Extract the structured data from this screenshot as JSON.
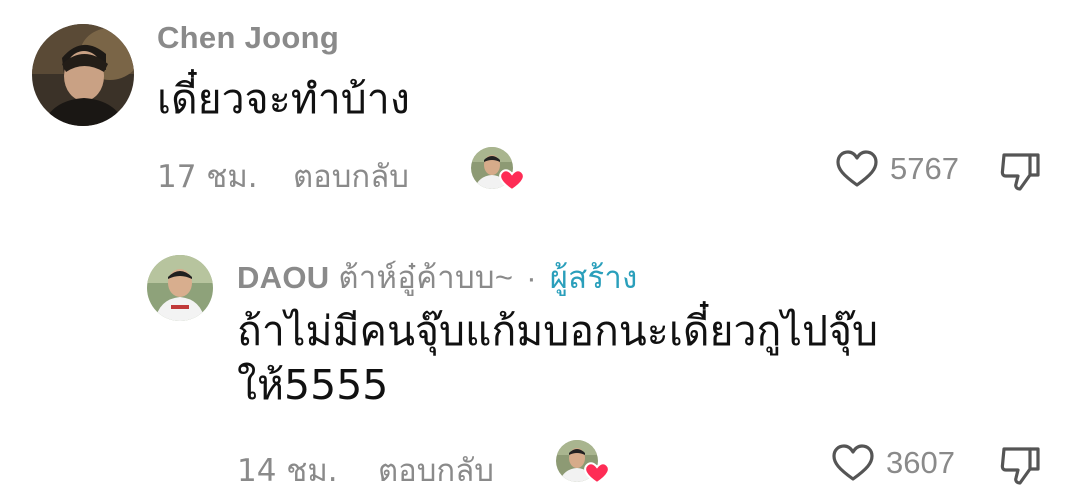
{
  "comments": [
    {
      "author": "Chen Joong",
      "text": "เดี๋ยวจะทำบ้าง",
      "time": "17 ชม.",
      "reply_label": "ตอบกลับ",
      "likes": "5767"
    }
  ],
  "reply": {
    "author": "DAOU",
    "nickname": "ต้าห์อู๋ค้าบบ~",
    "separator": "·",
    "creator_label": "ผู้สร้าง",
    "text_line1": "ถ้าไม่มีคนจุ๊บแก้มบอกนะเดี๋ยวกูไปจุ๊บ",
    "text_line2": "ให้5555",
    "time": "14 ชม.",
    "reply_label": "ตอบกลับ",
    "likes": "3607"
  },
  "colors": {
    "creator_accent": "#2a9fbb",
    "heart_badge": "#fe2c55",
    "muted_text": "#8a8a8a"
  },
  "icons": {
    "like": "heart-outline-icon",
    "dislike": "thumbs-down-icon",
    "creator_liked": "heart-badge-icon"
  }
}
